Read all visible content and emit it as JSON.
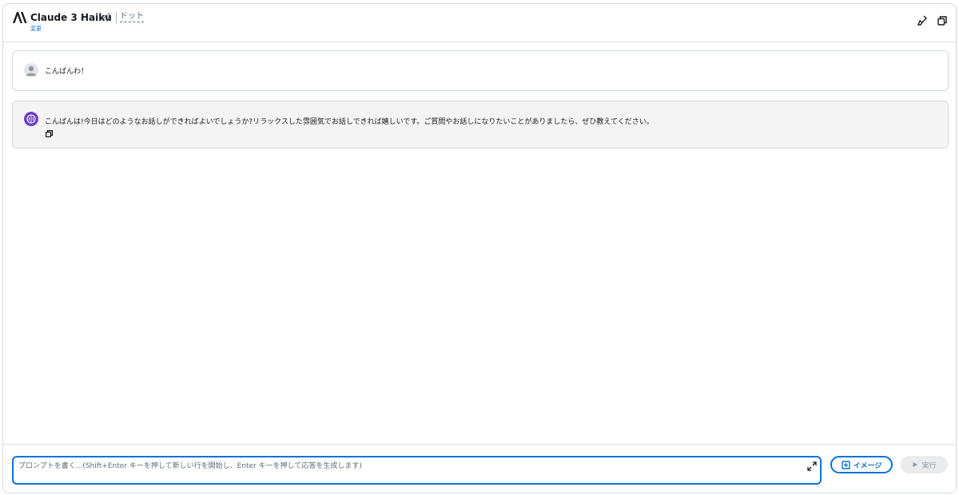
{
  "header": {
    "model_name": "Claude 3 Haiku",
    "model_version": "v1",
    "model_variant": "ドット",
    "change_link": "変更",
    "icons": [
      "logo-icon",
      "clear-icon",
      "copy-icon"
    ]
  },
  "messages": [
    {
      "role": "user",
      "text": "こんばんわ！"
    },
    {
      "role": "assistant",
      "text": "こんばんは!今日はどのようなお話しができればよいでしょうか?リラックスした雰囲気でお話しできれば嬉しいです。ご質問やお話しになりたいことがありましたら、ぜひ教えてください。"
    }
  ],
  "composer": {
    "placeholder": "プロンプトを書く...(Shift+Enter キーを押して新しい行を開始し、Enter キーを押して応答を生成します)",
    "value": "",
    "image_button": "イメージ",
    "run_button": "実行"
  },
  "colors": {
    "accent": "#0972d3",
    "assistant_avatar": "#6b3fc8",
    "assistant_bg": "#f4f4f4",
    "disabled_bg": "#e9ebed"
  }
}
